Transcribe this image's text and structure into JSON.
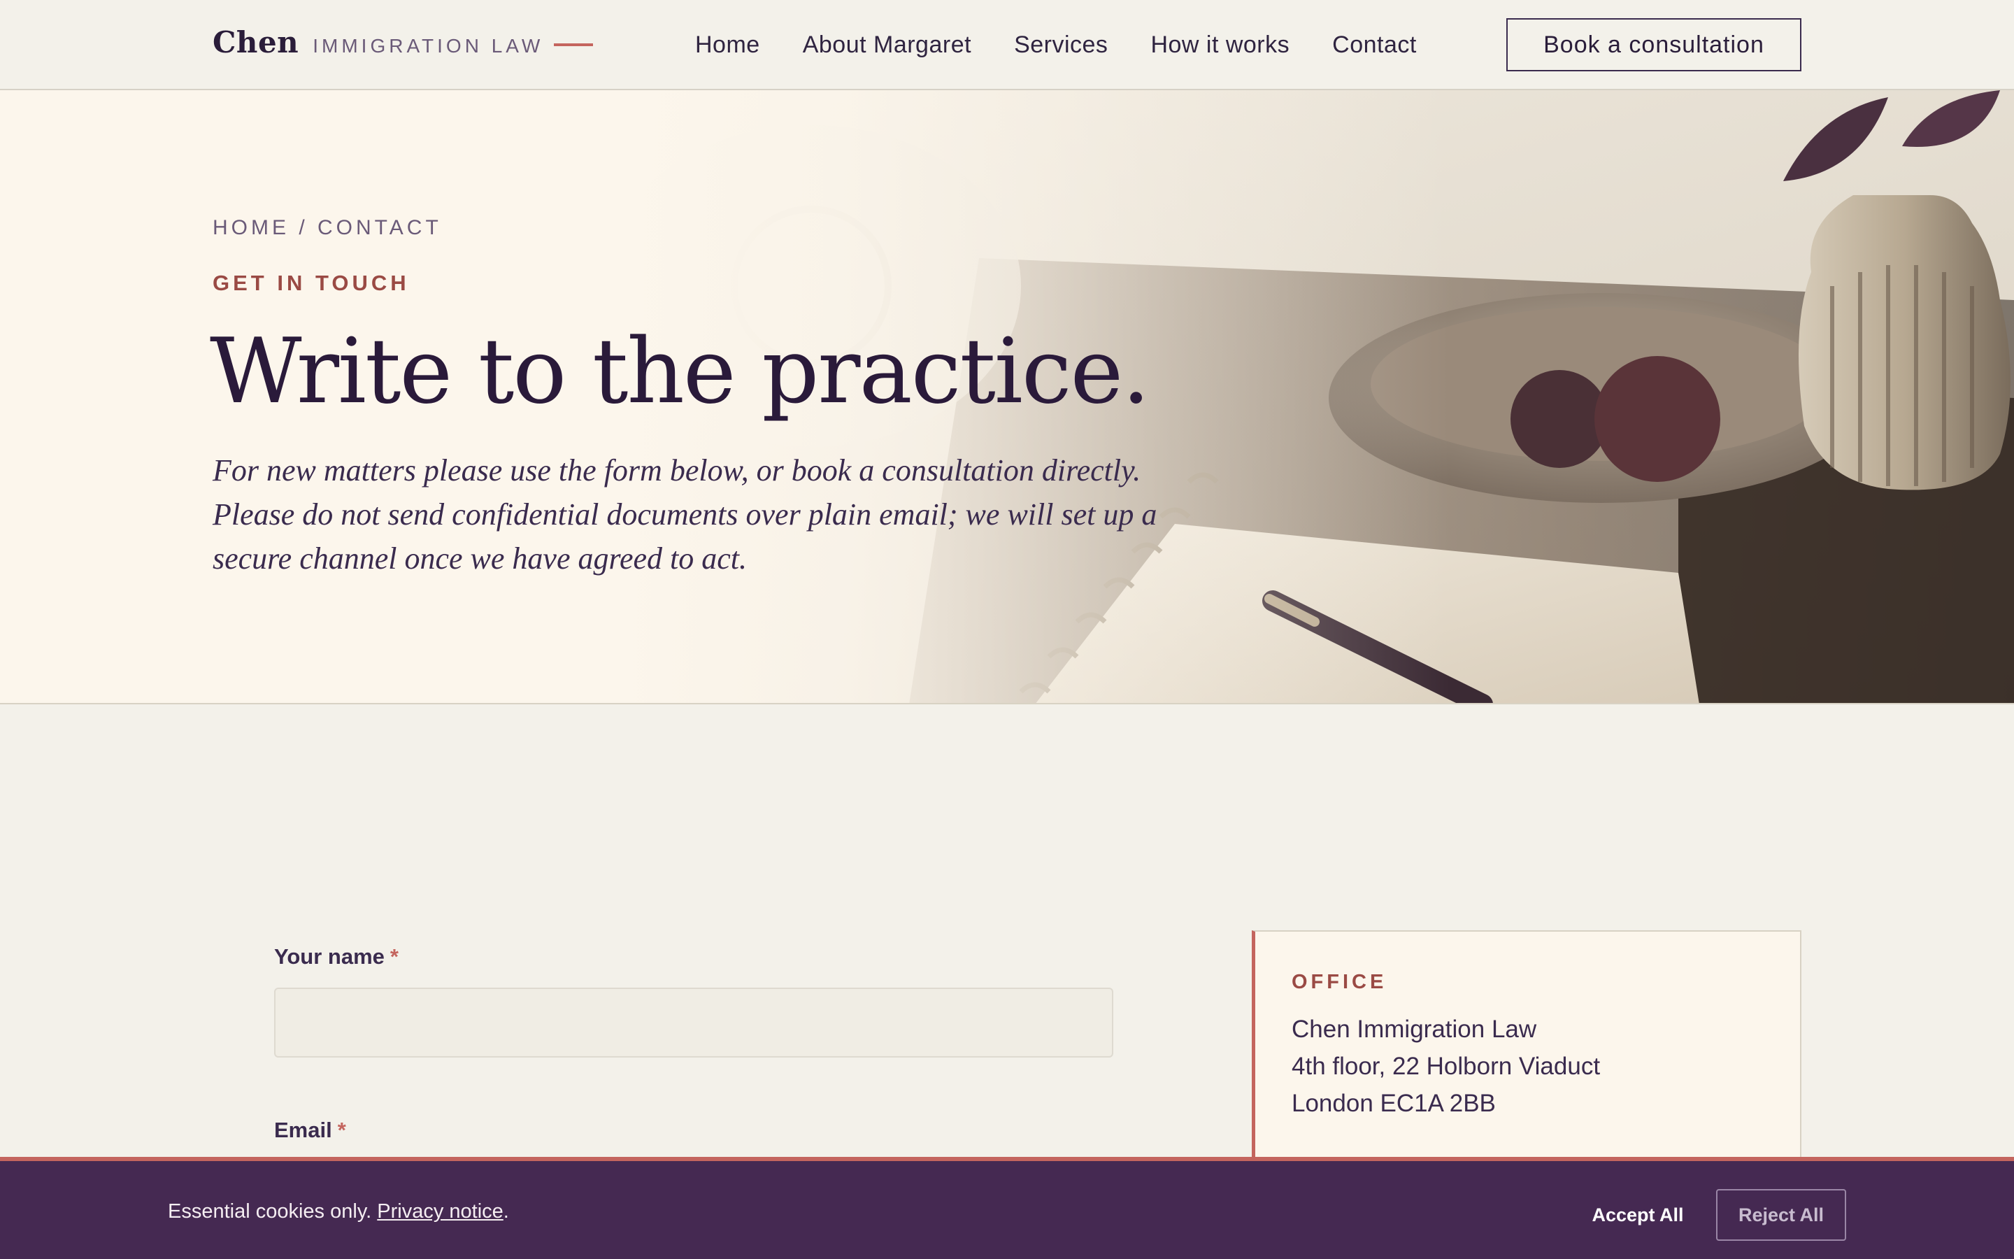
{
  "header": {
    "brand_name": "Chen",
    "brand_sub": "IMMIGRATION LAW",
    "nav": [
      "Home",
      "About Margaret",
      "Services",
      "How it works",
      "Contact"
    ],
    "cta": "Book a consultation"
  },
  "hero": {
    "breadcrumb": "HOME / CONTACT",
    "eyebrow": "GET IN TOUCH",
    "title": "Write to the practice.",
    "lead": "For new matters please use the form below, or book a consultation directly. Please do not send confidential documents over plain email; we will set up a secure channel once we have agreed to act."
  },
  "form": {
    "name_label": "Your name",
    "email_label": "Email",
    "required_mark": "*",
    "name_value": ""
  },
  "office": {
    "eyebrow": "OFFICE",
    "lines": [
      "Chen Immigration Law",
      "4th floor, 22 Holborn Viaduct",
      "London EC1A 2BB"
    ]
  },
  "cookie": {
    "text": "Essential cookies only.",
    "link": "Privacy notice",
    "period": ".",
    "accept": "Accept All",
    "reject": "Reject All"
  },
  "colors": {
    "accent": "#c4655e",
    "ink": "#2a1a3a",
    "banner": "#452952",
    "page": "#f3f1ea",
    "cream": "#fcf6ec"
  },
  "icons": {
    "hero": "desk-still-life-illustration"
  }
}
